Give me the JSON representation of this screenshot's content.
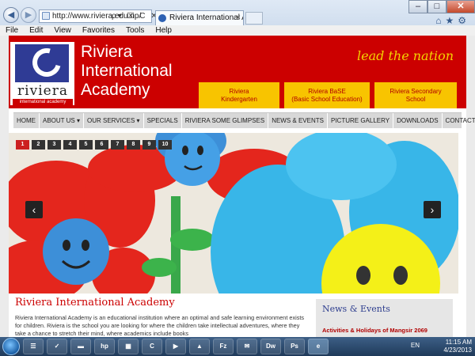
{
  "browser": {
    "url": "http://www.riviera.edu.np/",
    "tab_title": "Riviera International Acade...",
    "menu": [
      "File",
      "Edit",
      "View",
      "Favorites",
      "Tools",
      "Help"
    ],
    "tab_close": "×",
    "addr_tools": "ρ▾ ☒ C ✕",
    "window_controls": {
      "minimize": "–",
      "maximize": "□",
      "close": "✕"
    },
    "right_icons": "⌂★⚙"
  },
  "header": {
    "logo_word": "riviera",
    "logo_tag": "international academy",
    "site_name_lines": [
      "Riviera",
      "International",
      "Academy"
    ],
    "tagline": "lead the nation",
    "programs": [
      {
        "line1": "Riviera",
        "line2": "Kindergarten"
      },
      {
        "line1": "Riviera BaSE",
        "line2": "(Basic School Education)"
      },
      {
        "line1": "Riviera Secondary",
        "line2": "School"
      }
    ]
  },
  "nav": {
    "items": [
      "HOME",
      "ABOUT US ▾",
      "OUR SERVICES ▾",
      "SPECIALS",
      "RIVIERA SOME GLIMPSES",
      "NEWS & EVENTS",
      "PICTURE GALLERY",
      "DOWNLOADS",
      "CONTACT US"
    ]
  },
  "slider": {
    "pages": [
      "1",
      "2",
      "3",
      "4",
      "5",
      "6",
      "7",
      "8",
      "9",
      "10"
    ],
    "active_page": "1",
    "prev_label": "‹",
    "next_label": "›"
  },
  "content": {
    "title": "Riviera International Academy",
    "text": "Riviera International Academy is an educational institution where an optimal and safe learning environment exists for children. Riviera is the school you are looking for where the children take intellectual adventures, where they take a chance to stretch their mind, where academics include books"
  },
  "news": {
    "title": "News & Events",
    "item": "Activities & Holidays of Mangsir 2069"
  },
  "taskbar": {
    "apps": [
      "☰",
      "✓",
      "▬",
      "hp",
      "▦",
      "C",
      "▶",
      "▲",
      "Fz",
      "✉",
      "Dw",
      "Ps",
      "e"
    ],
    "lang": "EN",
    "time": "11:15 AM",
    "date": "4/23/2013"
  },
  "colors": {
    "brand_red": "#cc0000",
    "program_yellow": "#f8c400",
    "tagline_yellow": "#f3d200",
    "logo_blue": "#2f3b95"
  }
}
